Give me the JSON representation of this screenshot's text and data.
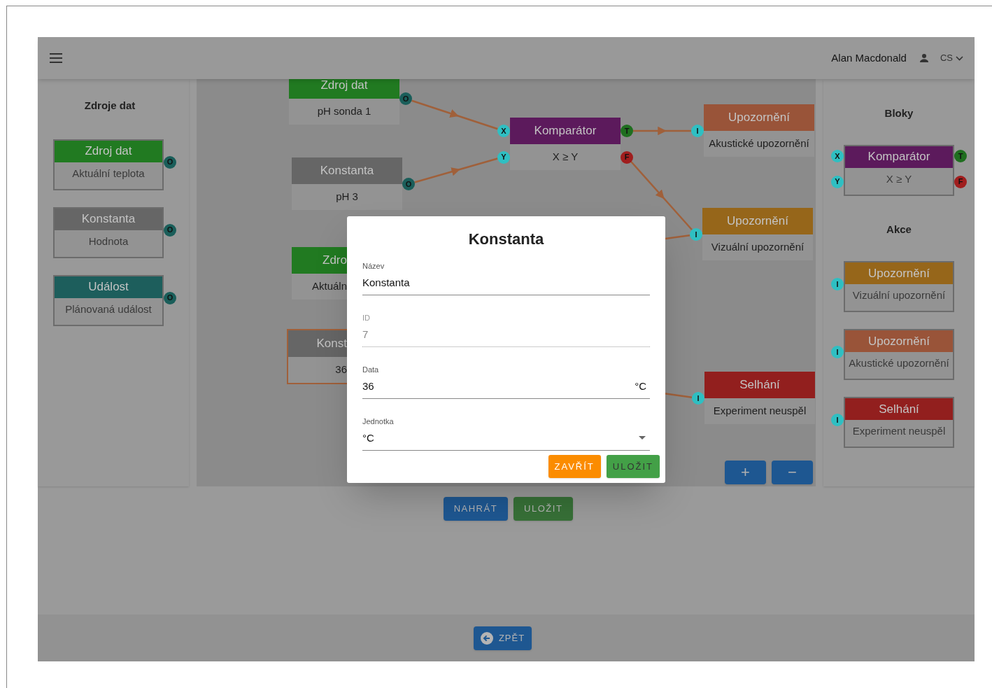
{
  "header": {
    "user": "Alan Macdonald",
    "language": "CS"
  },
  "sources_panel": {
    "title": "Zdroje dat",
    "blocks": [
      {
        "title": "Zdroj dat",
        "subtitle": "Aktuální teplota",
        "color": "#217a21",
        "ports": [
          {
            "label": "O",
            "kind": "output"
          }
        ]
      },
      {
        "title": "Konstanta",
        "subtitle": "Hodnota",
        "color": "#666666",
        "ports": [
          {
            "label": "O",
            "kind": "output"
          }
        ]
      },
      {
        "title": "Událost",
        "subtitle": "Plánovaná událost",
        "color": "#1d5e5c",
        "ports": [
          {
            "label": "O",
            "kind": "output"
          }
        ]
      }
    ]
  },
  "canvas": {
    "nodes": [
      {
        "title": "Zdroj dat",
        "subtitle": "pH sonda 1",
        "color": "#217a21",
        "selected": false,
        "ports": [
          {
            "label": "O",
            "kind": "output"
          }
        ]
      },
      {
        "title": "Konstanta",
        "subtitle": "pH 3",
        "color": "#666666",
        "selected": false,
        "ports": [
          {
            "label": "O",
            "kind": "output"
          }
        ]
      },
      {
        "title": "Zdro",
        "subtitle": "Aktuáln",
        "color": "#217a21",
        "selected": false
      },
      {
        "title": "Konst",
        "subtitle": "36",
        "color": "#666666",
        "selected": true
      },
      {
        "title": "Komparátor",
        "subtitle": "X ≥ Y",
        "color": "#5c1a5c",
        "selected": false,
        "ports": [
          {
            "label": "X",
            "kind": "input"
          },
          {
            "label": "Y",
            "kind": "input"
          },
          {
            "label": "T",
            "kind": "true"
          },
          {
            "label": "F",
            "kind": "false"
          }
        ]
      },
      {
        "title": "Upozornění",
        "subtitle": "Akustické upozornění",
        "color": "#995439",
        "selected": false,
        "ports": [
          {
            "label": "I",
            "kind": "input"
          }
        ]
      },
      {
        "title": "Upozornění",
        "subtitle": "Vizuální upozornění",
        "color": "#96661a",
        "selected": false,
        "ports": [
          {
            "label": "I",
            "kind": "input"
          }
        ]
      },
      {
        "title": "Selhání",
        "subtitle": "Experiment neuspěl",
        "color": "#921f1e",
        "selected": false,
        "ports": [
          {
            "label": "I",
            "kind": "input"
          }
        ]
      }
    ],
    "zoom_buttons": [
      "+",
      "−"
    ]
  },
  "blocks_panel": {
    "title": "Bloky",
    "blocks": [
      {
        "title": "Komparátor",
        "subtitle": "X ≥ Y",
        "color": "#5c1a5c",
        "ports": [
          {
            "label": "X",
            "kind": "input"
          },
          {
            "label": "Y",
            "kind": "input"
          },
          {
            "label": "T",
            "kind": "true"
          },
          {
            "label": "F",
            "kind": "false"
          }
        ]
      }
    ],
    "actions_title": "Akce",
    "actions": [
      {
        "title": "Upozornění",
        "subtitle": "Vizuální upozornění",
        "color": "#96661a",
        "ports": [
          {
            "label": "I",
            "kind": "input"
          }
        ]
      },
      {
        "title": "Upozornění",
        "subtitle": "Akustické upozornění",
        "color": "#995439",
        "ports": [
          {
            "label": "I",
            "kind": "input"
          }
        ]
      },
      {
        "title": "Selhání",
        "subtitle": "Experiment neuspěl",
        "color": "#921f1e",
        "ports": [
          {
            "label": "I",
            "kind": "input"
          }
        ]
      }
    ]
  },
  "buttons": [
    "NAHRÁT",
    "ULOŽIT"
  ],
  "footer": {
    "back_button": "ZPĚT"
  },
  "dialog": {
    "title": "Konstanta",
    "fields": [
      {
        "label": "Název",
        "value": "Konstanta",
        "kind": "text"
      },
      {
        "label": "ID",
        "value": "7",
        "kind": "disabled"
      },
      {
        "label": "Data",
        "value": "36",
        "suffix": "°C",
        "kind": "text"
      },
      {
        "label": "Jednotka",
        "value": "°C",
        "kind": "select"
      }
    ],
    "buttons": [
      "ZAVŘÍT",
      "ULOŽIT"
    ]
  }
}
